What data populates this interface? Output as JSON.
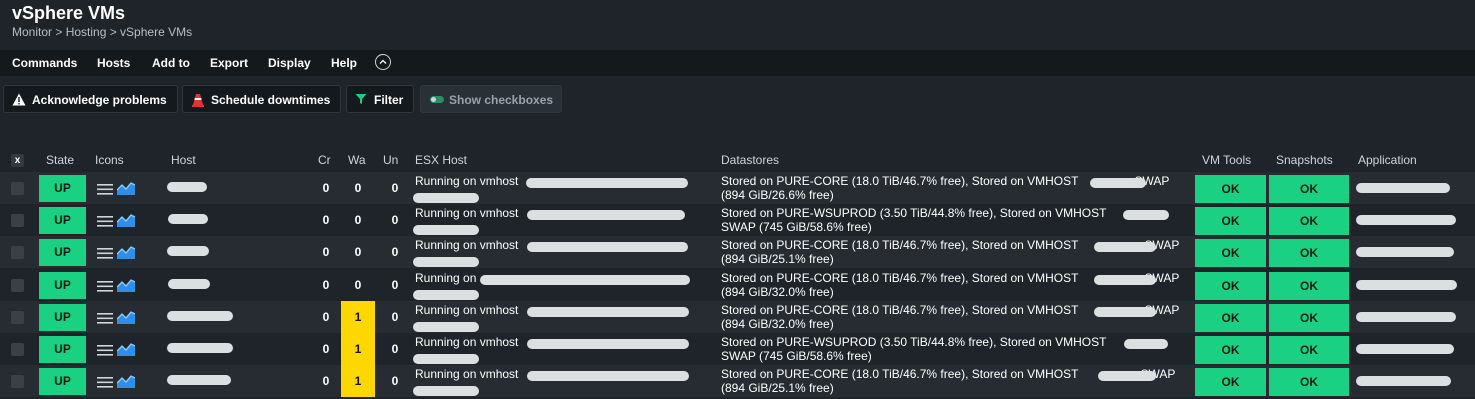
{
  "header": {
    "title": "vSphere VMs",
    "breadcrumb": "Monitor > Hosting > vSphere VMs"
  },
  "menu": {
    "items": [
      "Commands",
      "Hosts",
      "Add to",
      "Export",
      "Display",
      "Help"
    ]
  },
  "toolbar": {
    "acknowledge_label": "Acknowledge problems",
    "schedule_label": "Schedule downtimes",
    "filter_label": "Filter",
    "checkboxes_label": "Show checkboxes"
  },
  "table": {
    "select_all": "x",
    "columns": {
      "state": "State",
      "icons": "Icons",
      "host": "Host",
      "cr": "Cr",
      "wa": "Wa",
      "un": "Un",
      "esx": "ESX Host",
      "datastores": "Datastores",
      "vm_tools": "VM Tools",
      "snapshots": "Snapshots",
      "application": "Application"
    },
    "rows": [
      {
        "state": "UP",
        "cr": "0",
        "wa": "0",
        "un": "0",
        "esx": "Running on vmhost",
        "ds_line1a": "Stored on PURE-CORE (18.0 TiB/46.7% free), Stored on VMHOST",
        "ds_line1b": "SWAP",
        "ds_line2": "(894 GiB/26.6% free)",
        "vm_tools": "OK",
        "snapshots": "OK",
        "warn": false
      },
      {
        "state": "UP",
        "cr": "0",
        "wa": "0",
        "un": "0",
        "esx": "Running on vmhost",
        "ds_line1a": "Stored on PURE-WSUPROD (3.50 TiB/44.8% free), Stored on VMHOST",
        "ds_line1b": "",
        "ds_line2": "SWAP (745 GiB/58.6% free)",
        "vm_tools": "OK",
        "snapshots": "OK",
        "warn": false
      },
      {
        "state": "UP",
        "cr": "0",
        "wa": "0",
        "un": "0",
        "esx": "Running on vmhost",
        "ds_line1a": "Stored on PURE-CORE (18.0 TiB/46.7% free), Stored on VMHOST",
        "ds_line1b": "-SWAP",
        "ds_line2": "(894 GiB/25.1% free)",
        "vm_tools": "OK",
        "snapshots": "OK",
        "warn": false
      },
      {
        "state": "UP",
        "cr": "0",
        "wa": "0",
        "un": "0",
        "esx": "Running on",
        "ds_line1a": "Stored on PURE-CORE (18.0 TiB/46.7% free), Stored on VMHOST",
        "ds_line1b": "-SWAP",
        "ds_line2": "(894 GiB/32.0% free)",
        "vm_tools": "OK",
        "snapshots": "OK",
        "warn": false
      },
      {
        "state": "UP",
        "cr": "0",
        "wa": "1",
        "un": "0",
        "esx": "Running on vmhost",
        "ds_line1a": "Stored on PURE-CORE (18.0 TiB/46.7% free), Stored on VMHOST",
        "ds_line1b": "-SWAP",
        "ds_line2": "(894 GiB/32.0% free)",
        "vm_tools": "OK",
        "snapshots": "OK",
        "warn": true
      },
      {
        "state": "UP",
        "cr": "0",
        "wa": "1",
        "un": "0",
        "esx": "Running on vmhost",
        "ds_line1a": "Stored on PURE-WSUPROD (3.50 TiB/44.8% free), Stored on VMHOST",
        "ds_line1b": "",
        "ds_line2": "SWAP (745 GiB/58.6% free)",
        "vm_tools": "OK",
        "snapshots": "OK",
        "warn": true
      },
      {
        "state": "UP",
        "cr": "0",
        "wa": "1",
        "un": "0",
        "esx": "Running on vmhost",
        "ds_line1a": "Stored on PURE-CORE (18.0 TiB/46.7% free), Stored on VMHOST",
        "ds_line1b": "-SWAP",
        "ds_line2": "(894 GiB/25.1% free)",
        "vm_tools": "OK",
        "snapshots": "OK",
        "warn": true
      }
    ]
  },
  "colors": {
    "background": "#1e2429",
    "ok_green": "#1ad082",
    "warn_yellow": "#ffd700",
    "menubar": "#14191d"
  },
  "icons": [
    "warning-icon",
    "traffic-cone-icon",
    "filter-icon",
    "toggle-icon",
    "chevron-up-icon",
    "menu-icon",
    "graph-icon"
  ]
}
